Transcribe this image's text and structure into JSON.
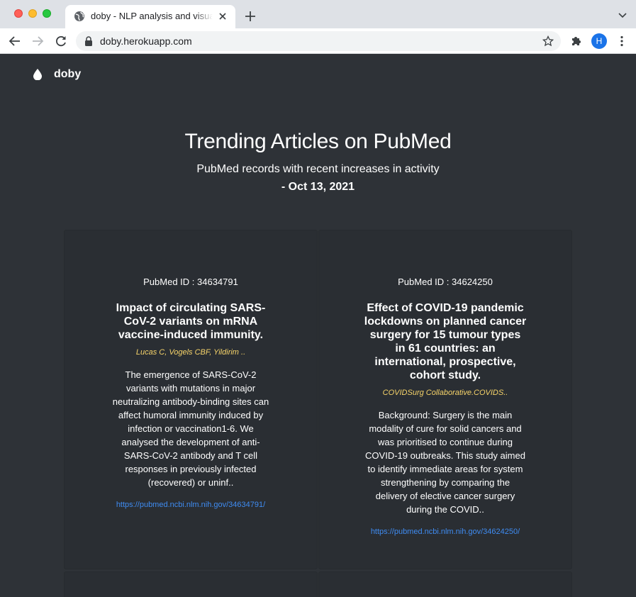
{
  "browser": {
    "tab_title": "doby - NLP analysis and visualization",
    "url": "doby.herokuapp.com",
    "profile_initial": "H"
  },
  "site": {
    "logo_text": "doby"
  },
  "hero": {
    "title": "Trending Articles on PubMed",
    "subtitle": "PubMed records with recent increases in activity",
    "date": "- Oct 13, 2021"
  },
  "articles": [
    {
      "pmid": "PubMed ID : 34634791",
      "title": "Impact of circulating SARS-CoV-2 variants on mRNA vaccine-induced immunity.",
      "authors": "Lucas C, Vogels CBF, Yildirim ..",
      "abstract": "The emergence of SARS-CoV-2 variants with mutations in major neutralizing antibody-binding sites can affect humoral immunity induced by infection or vaccination1-6. We analysed the development of anti-SARS-CoV-2 antibody and T cell responses in previously infected (recovered) or uninf..",
      "link": "https://pubmed.ncbi.nlm.nih.gov/34634791/"
    },
    {
      "pmid": "PubMed ID : 34624250",
      "title": "Effect of COVID-19 pandemic lockdowns on planned cancer surgery for 15 tumour types in 61 countries: an international, prospective, cohort study.",
      "authors": "COVIDSurg Collaborative.COVIDS..",
      "abstract": "Background: Surgery is the main modality of cure for solid cancers and was prioritised to continue during COVID-19 outbreaks. This study aimed to identify immediate areas for system strengthening by comparing the delivery of elective cancer surgery during the COVID..",
      "link": "https://pubmed.ncbi.nlm.nih.gov/34624250/"
    }
  ],
  "colors": {
    "page_bg": "#2e3237",
    "card_bg": "#2a2e33",
    "author_accent": "#f7d46a",
    "link": "#3f8cf2"
  }
}
